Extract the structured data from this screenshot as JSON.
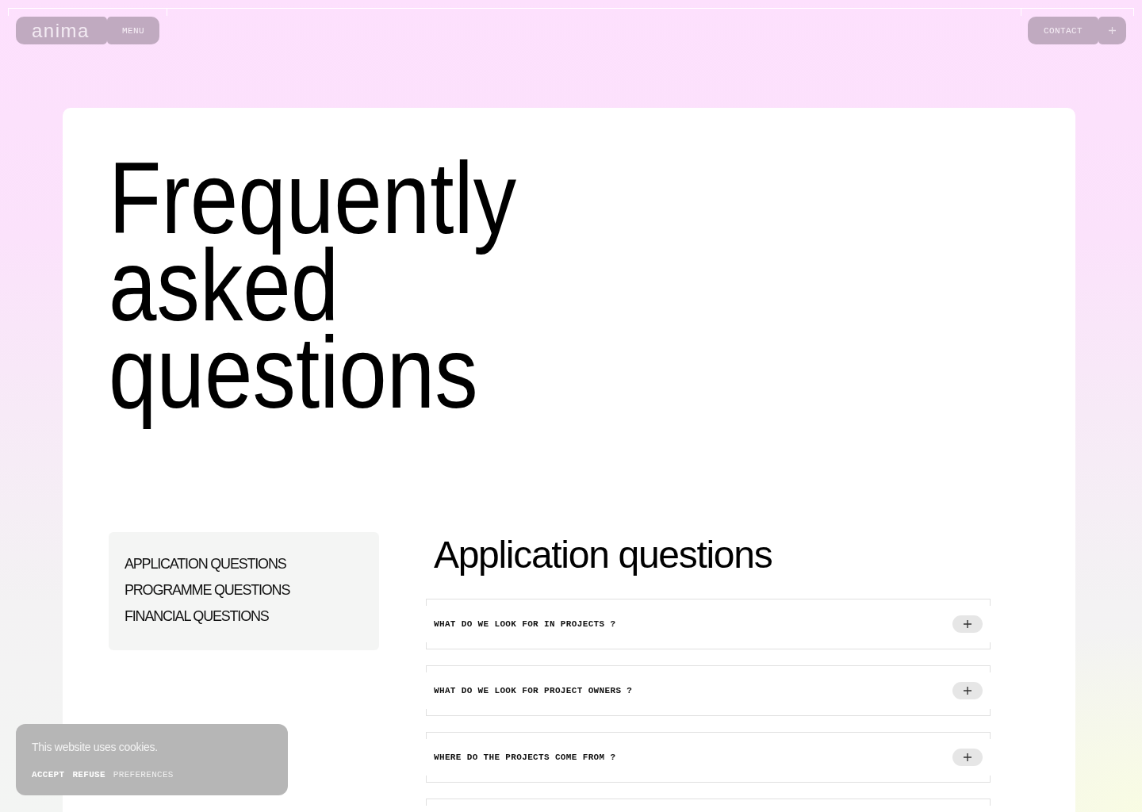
{
  "header": {
    "logo": "anima",
    "menu_button": "MENU",
    "contact_button": "CONTACT"
  },
  "page_title": "Frequently asked questions",
  "sidebar": {
    "items": [
      {
        "label": "APPLICATION QUESTIONS"
      },
      {
        "label": "PROGRAMME QUESTIONS"
      },
      {
        "label": "FINANCIAL QUESTIONS"
      }
    ]
  },
  "section": {
    "title": "Application questions",
    "questions": [
      {
        "text": "WHAT DO WE LOOK FOR IN PROJECTS ?",
        "expanded": false
      },
      {
        "text": "WHAT DO WE LOOK FOR PROJECT OWNERS ?",
        "expanded": false
      },
      {
        "text": "WHERE DO THE PROJECTS COME FROM ?",
        "expanded": false
      }
    ]
  },
  "cookie_banner": {
    "message": "This website uses cookies.",
    "actions": [
      {
        "label": "ACCEPT",
        "disabled": false
      },
      {
        "label": "REFUSE",
        "disabled": false
      },
      {
        "label": "PREFERENCES",
        "disabled": true
      }
    ]
  }
}
